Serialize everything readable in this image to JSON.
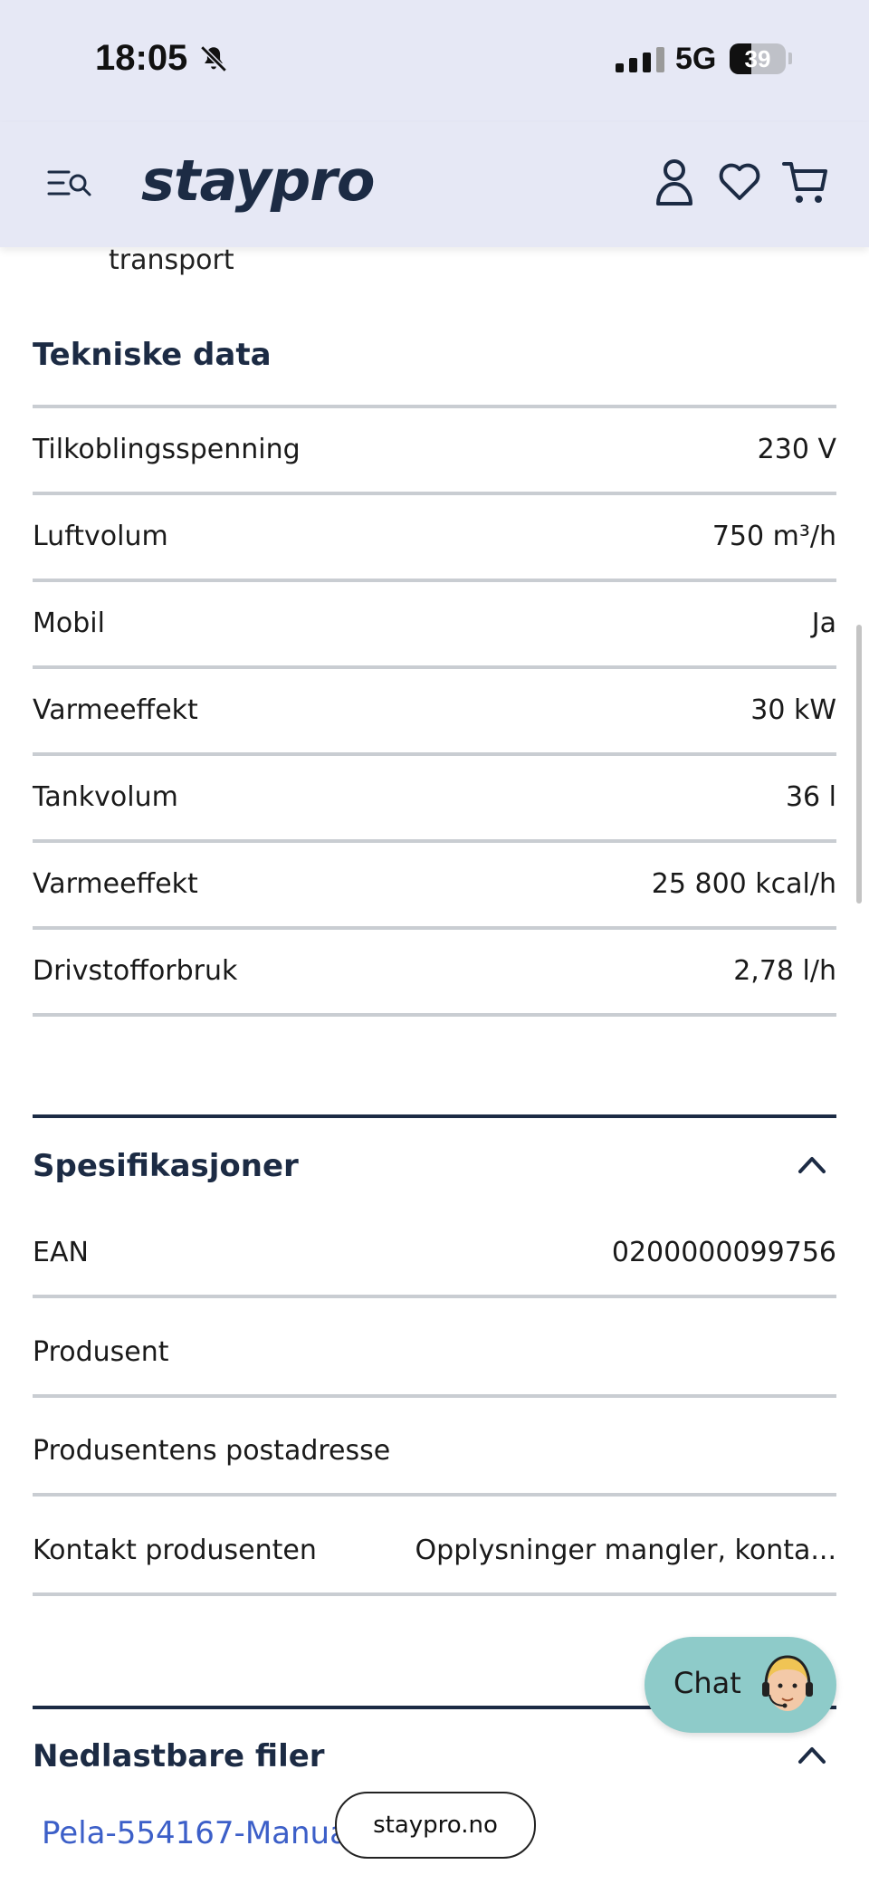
{
  "status_bar": {
    "time": "18:05",
    "network": "5G",
    "battery": "39",
    "battery_level": 0.39
  },
  "header": {
    "logo": "staypro"
  },
  "previous_text": "transport",
  "tech": {
    "title": "Tekniske data",
    "rows": [
      {
        "label": "Tilkoblingsspenning",
        "value": "230 V"
      },
      {
        "label": "Luftvolum",
        "value": "750 m³/h"
      },
      {
        "label": "Mobil",
        "value": "Ja"
      },
      {
        "label": "Varmeeffekt",
        "value": "30 kW"
      },
      {
        "label": "Tankvolum",
        "value": "36 l"
      },
      {
        "label": "Varmeeffekt",
        "value": "25 800 kcal/h"
      },
      {
        "label": "Drivstofforbruk",
        "value": "2,78 l/h"
      }
    ]
  },
  "specs": {
    "title": "Spesifikasjoner",
    "rows": [
      {
        "label": "EAN",
        "value": "0200000099756"
      },
      {
        "label": "Produsent",
        "value": ""
      },
      {
        "label": "Produsentens postadresse",
        "value": ""
      },
      {
        "label": "Kontakt produsenten",
        "value": "Opplysninger mangler, konta..."
      }
    ]
  },
  "downloads": {
    "title": "Nedlastbare filer",
    "file": "Pela-554167-Manua"
  },
  "chat": {
    "label": "Chat"
  },
  "url": "staypro.no"
}
